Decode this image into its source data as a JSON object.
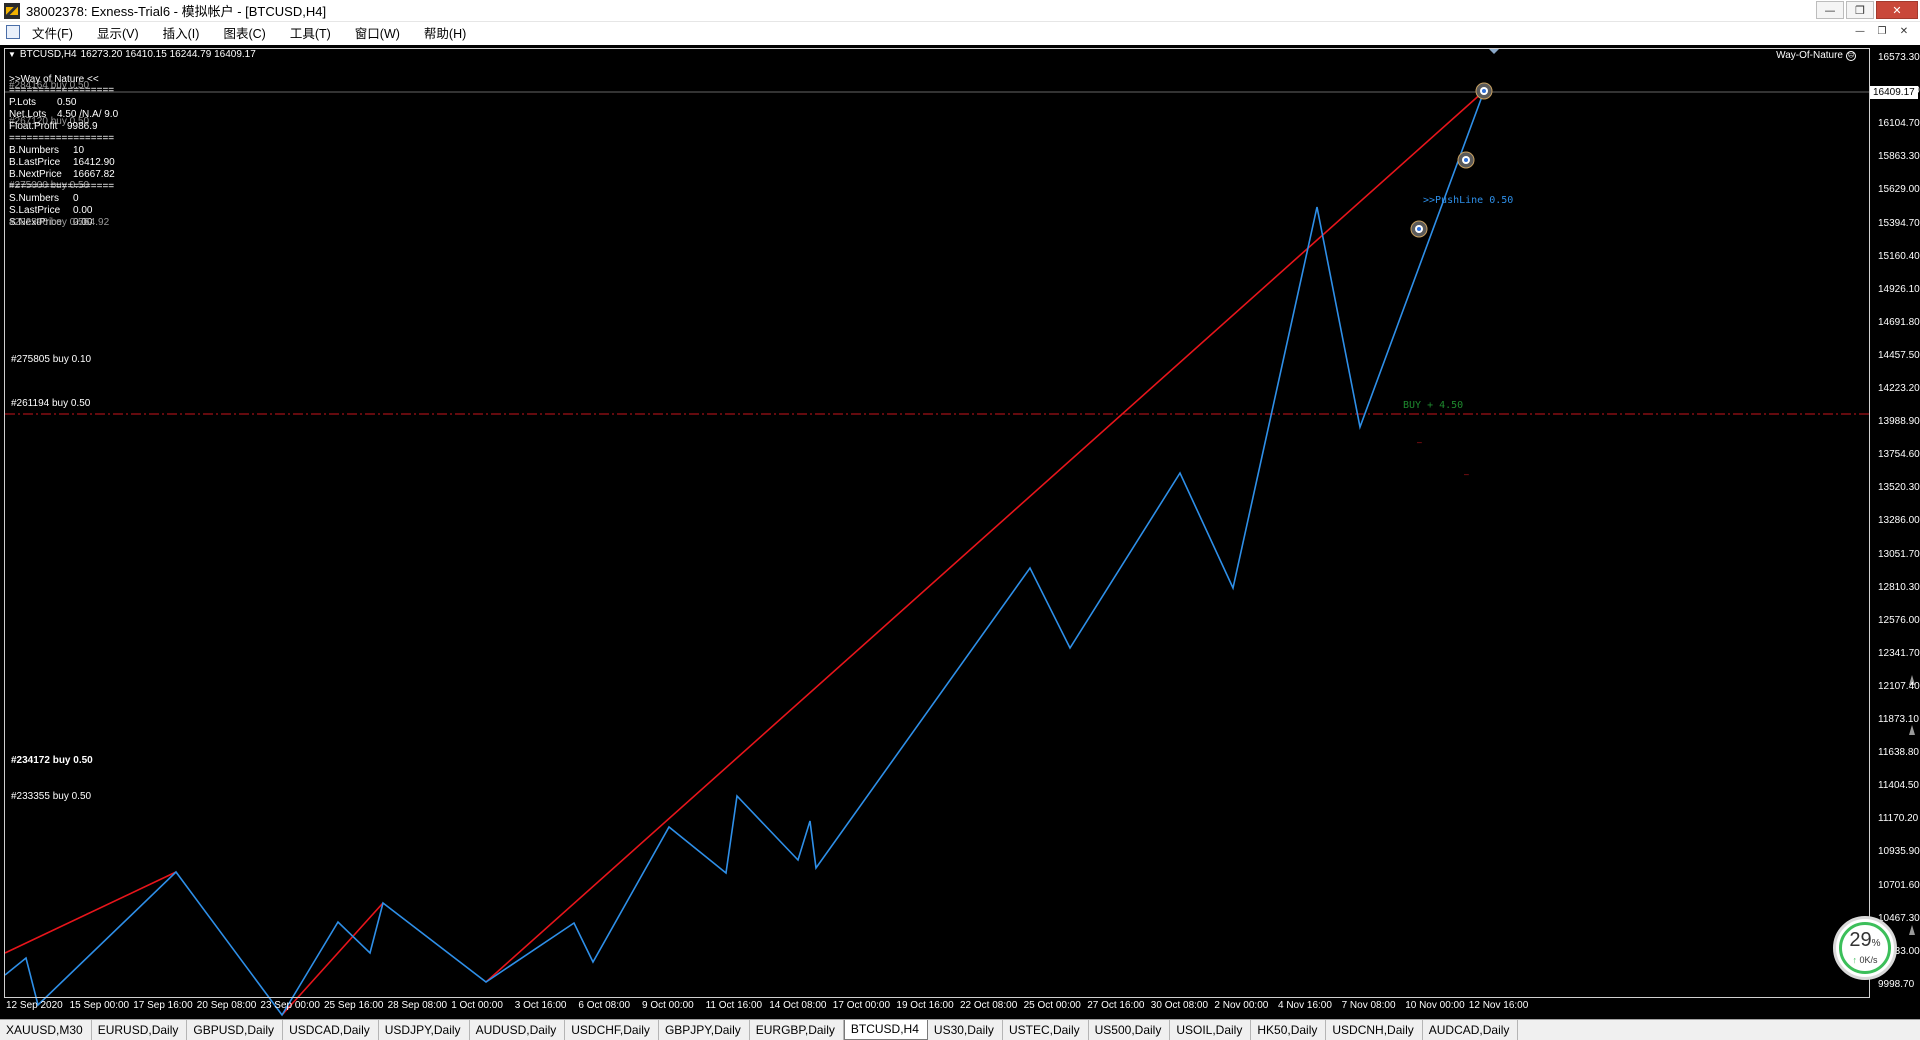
{
  "window": {
    "title": "38002378: Exness-Trial6 - 模拟帐户 - [BTCUSD,H4]",
    "minimize": "—",
    "restore": "❐",
    "close": "✕"
  },
  "menu": {
    "items": [
      "文件(F)",
      "显示(V)",
      "插入(I)",
      "图表(C)",
      "工具(T)",
      "窗口(W)",
      "帮助(H)"
    ],
    "mdi_minimize": "—",
    "mdi_restore": "❐",
    "mdi_close": "✕"
  },
  "chart": {
    "header": {
      "arrow": "▼",
      "symbol_timeframe": "BTCUSD,H4",
      "ohlc": "16273.20 16410.15 16244.79 16409.17"
    },
    "ea_name": "Way-Of-Nature",
    "ea_face": "☹",
    "current_price": "16409.17",
    "price_axis": [
      "16573.30",
      "16339.00",
      "16104.70",
      "15863.30",
      "15629.00",
      "15394.70",
      "15160.40",
      "14926.10",
      "14691.80",
      "14457.50",
      "14223.20",
      "13988.90",
      "13754.60",
      "13520.30",
      "13286.00",
      "13051.70",
      "12810.30",
      "12576.00",
      "12341.70",
      "12107.40",
      "11873.10",
      "11638.80",
      "11404.50",
      "11170.20",
      "10935.90",
      "10701.60",
      "10467.30",
      "10233.00",
      "9998.70"
    ],
    "time_axis": [
      "12 Sep 2020",
      "15 Sep 00:00",
      "17 Sep 16:00",
      "20 Sep 08:00",
      "23 Sep 00:00",
      "25 Sep 16:00",
      "28 Sep 08:00",
      "1 Oct 00:00",
      "3 Oct 16:00",
      "6 Oct 08:00",
      "9 Oct 00:00",
      "11 Oct 16:00",
      "14 Oct 08:00",
      "17 Oct 00:00",
      "19 Oct 16:00",
      "22 Oct 08:00",
      "25 Oct 00:00",
      "27 Oct 16:00",
      "30 Oct 08:00",
      "2 Nov 00:00",
      "4 Nov 16:00",
      "7 Nov 08:00",
      "10 Nov 00:00",
      "12 Nov 16:00"
    ],
    "colors": {
      "background": "#000000",
      "price_line": "#2e8fe8",
      "trend_line": "#e8151b",
      "dash_line": "#c8141b",
      "annotation_green": "#1e8a2e",
      "annotation_blue": "#2e8fe8"
    }
  },
  "info_panel": {
    "title": ">>Way of Nature <<",
    "separator": "==================",
    "overlap_order_top": "#284164 buy 0.50",
    "p_lots_label": "P.Lots",
    "p_lots_value": "0.50",
    "net_lots_label": "Net.Lots",
    "net_lots_value": "4.50  /N.A/  9.0",
    "float_profit_label": "Float.Profit",
    "float_profit_value": "9986.9",
    "overlap_order_mid": "#267120 buy 0.50",
    "b_numbers_label": "B.Numbers",
    "b_numbers_value": "10",
    "b_lastprice_label": "B.LastPrice",
    "b_lastprice_value": "16412.90",
    "b_nextprice_label": "B.NextPrice",
    "b_nextprice_value": "16667.82",
    "overlap_order_low": "#275000 buy 0.50",
    "s_numbers_label": "S.Numbers",
    "s_numbers_value": "0",
    "s_lastprice_label": "S.LastPrice",
    "s_lastprice_value": "0.00",
    "s_nextprice_label": "S.NextPrice",
    "s_nextprice_value": "0.00",
    "overlap_order_s": "#282596 buy 0.50",
    "overlap_value_s": "2764.92"
  },
  "order_labels": [
    {
      "text": "#275805 buy 0.10",
      "bold": false,
      "key": "o1"
    },
    {
      "text": "#261194 buy 0.50",
      "bold": false,
      "key": "o2"
    },
    {
      "text": "#234172 buy 0.50",
      "bold": true,
      "key": "o3"
    },
    {
      "text": "#233355 buy 0.50",
      "bold": false,
      "key": "o4"
    }
  ],
  "annotations": {
    "push_line": ">>PushLine  0.50",
    "buy_level": "BUY + 4.50",
    "dash1": "—",
    "dash2": "—"
  },
  "gauge": {
    "percent": "29",
    "percent_sign": "%",
    "up_arrow": "↑",
    "rate": "0K/s"
  },
  "tabs": [
    {
      "label": "XAUUSD,M30",
      "active": false
    },
    {
      "label": "EURUSD,Daily",
      "active": false
    },
    {
      "label": "GBPUSD,Daily",
      "active": false
    },
    {
      "label": "USDCAD,Daily",
      "active": false
    },
    {
      "label": "USDJPY,Daily",
      "active": false
    },
    {
      "label": "AUDUSD,Daily",
      "active": false
    },
    {
      "label": "USDCHF,Daily",
      "active": false
    },
    {
      "label": "GBPJPY,Daily",
      "active": false
    },
    {
      "label": "EURGBP,Daily",
      "active": false
    },
    {
      "label": "BTCUSD,H4",
      "active": true
    },
    {
      "label": "US30,Daily",
      "active": false
    },
    {
      "label": "USTEC,Daily",
      "active": false
    },
    {
      "label": "US500,Daily",
      "active": false
    },
    {
      "label": "USOIL,Daily",
      "active": false
    },
    {
      "label": "HK50,Daily",
      "active": false
    },
    {
      "label": "USDCNH,Daily",
      "active": false
    },
    {
      "label": "AUDCAD,Daily",
      "active": false
    }
  ]
}
